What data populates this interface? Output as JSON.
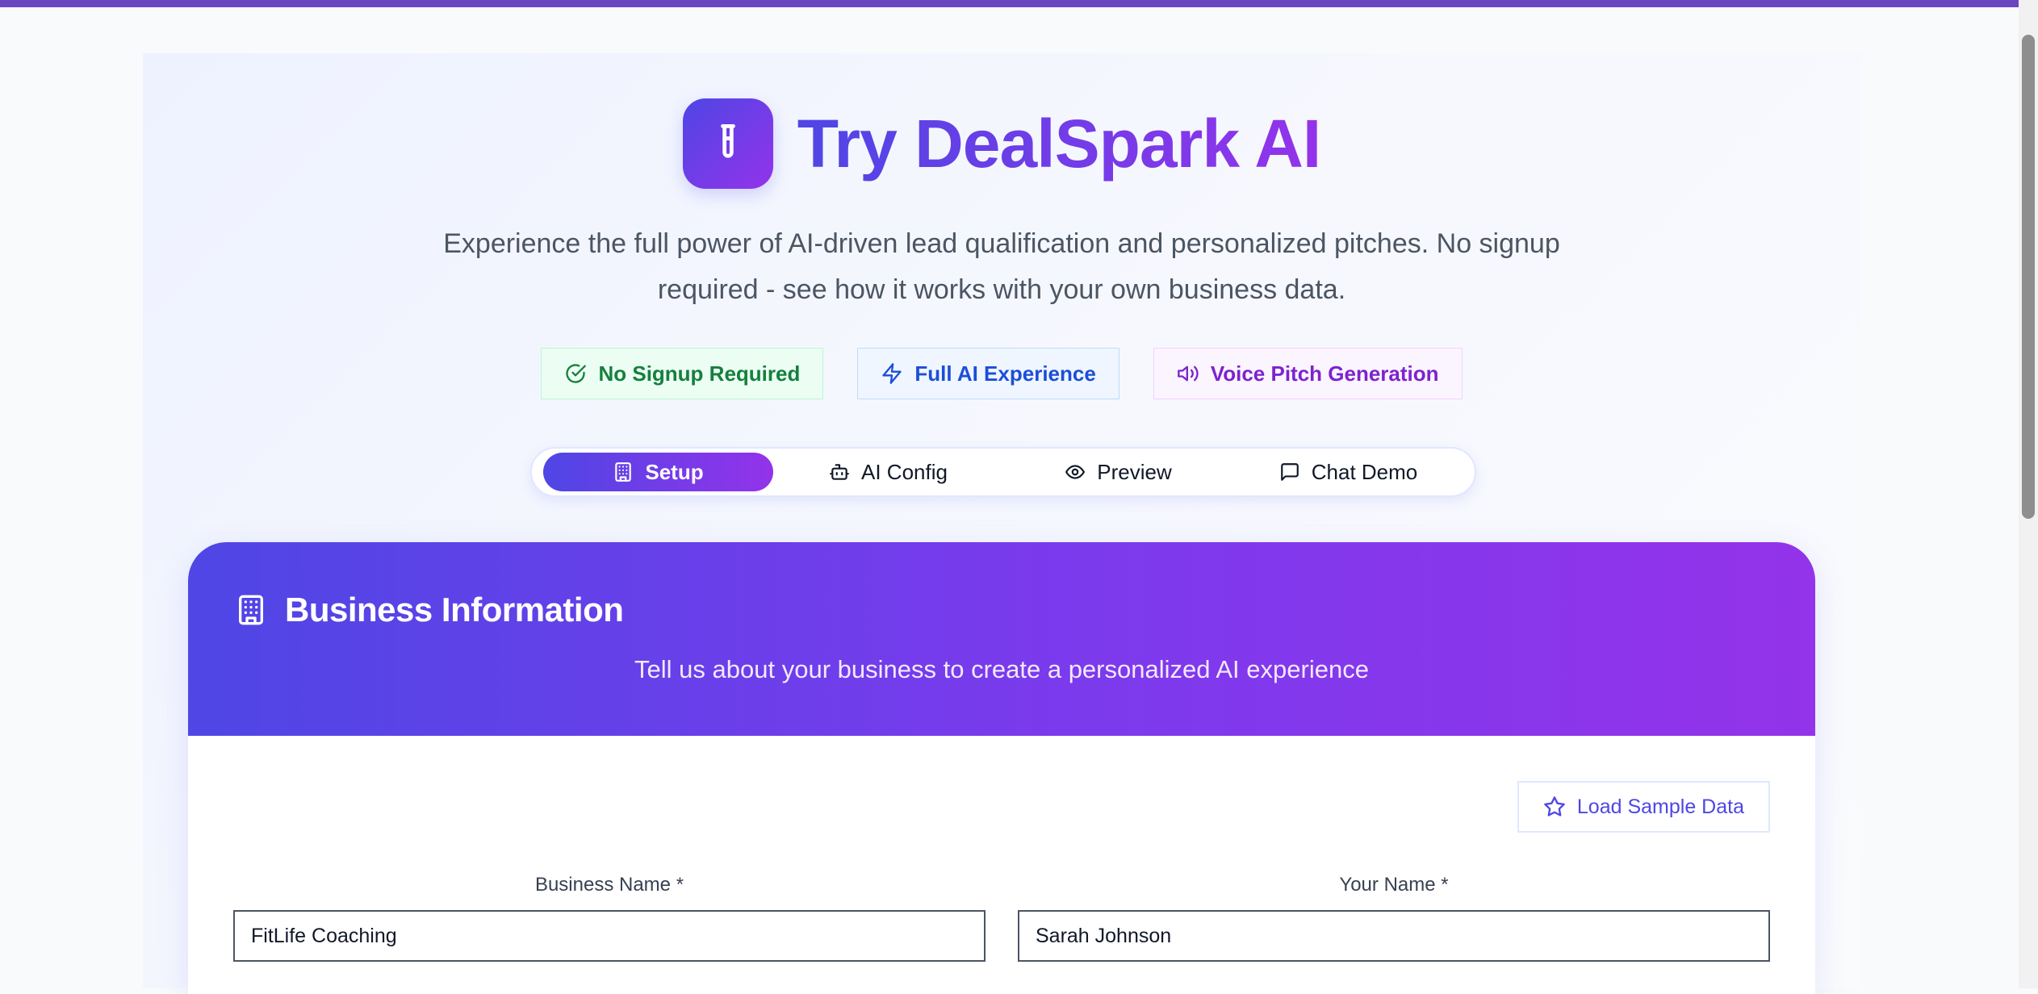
{
  "hero": {
    "title": "Try DealSpark AI",
    "subtitle": "Experience the full power of AI-driven lead qualification and personalized pitches. No signup required - see how it works with your own business data.",
    "logo_icon": "test-tube-icon"
  },
  "badges": [
    {
      "label": "No Signup Required",
      "icon": "check-circle-icon",
      "color": "#15803d"
    },
    {
      "label": "Full AI Experience",
      "icon": "zap-icon",
      "color": "#1d4ed8"
    },
    {
      "label": "Voice Pitch Generation",
      "icon": "volume-icon",
      "color": "#7e22ce"
    }
  ],
  "tabs": [
    {
      "label": "Setup",
      "icon": "building-icon",
      "active": true
    },
    {
      "label": "AI Config",
      "icon": "bot-icon",
      "active": false
    },
    {
      "label": "Preview",
      "icon": "eye-icon",
      "active": false
    },
    {
      "label": "Chat Demo",
      "icon": "message-square-icon",
      "active": false
    }
  ],
  "card": {
    "title": "Business Information",
    "subtitle": "Tell us about your business to create a personalized AI experience",
    "sample_button": "Load Sample Data"
  },
  "form": {
    "business_name": {
      "label": "Business Name *",
      "value": "FitLife Coaching"
    },
    "your_name": {
      "label": "Your Name *",
      "value": "Sarah Johnson"
    }
  },
  "colors": {
    "accent_start": "#4f46e5",
    "accent_end": "#9333ea",
    "top_bar": "#6b46c1"
  }
}
